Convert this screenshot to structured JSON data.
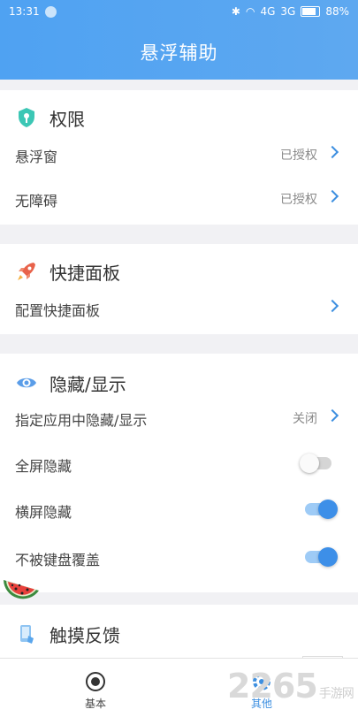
{
  "status_bar": {
    "time": "13:31",
    "net1": "4G",
    "net2": "3G",
    "battery": "88%"
  },
  "header": {
    "title": "悬浮辅助"
  },
  "permissions": {
    "title": "权限",
    "rows": [
      {
        "label": "悬浮窗",
        "value": "已授权"
      },
      {
        "label": "无障碍",
        "value": "已授权"
      }
    ]
  },
  "quick_panel": {
    "title": "快捷面板",
    "rows": [
      {
        "label": "配置快捷面板"
      }
    ]
  },
  "hide_show": {
    "title": "隐藏/显示",
    "app_row": {
      "label": "指定应用中隐藏/显示",
      "value": "关闭"
    },
    "toggles": [
      {
        "label": "全屏隐藏",
        "on": false
      },
      {
        "label": "横屏隐藏",
        "on": true
      },
      {
        "label": "不被键盘覆盖",
        "on": true
      }
    ]
  },
  "touch_feedback": {
    "title": "触摸反馈"
  },
  "bottom_nav": {
    "basic": "基本",
    "other": "其他"
  },
  "watermark": {
    "brand": "2265",
    "site": "手游网"
  },
  "colors": {
    "accent": "#3d8fe8",
    "header": "#4fa2f2",
    "toggle_off": "#d5d5d5"
  }
}
